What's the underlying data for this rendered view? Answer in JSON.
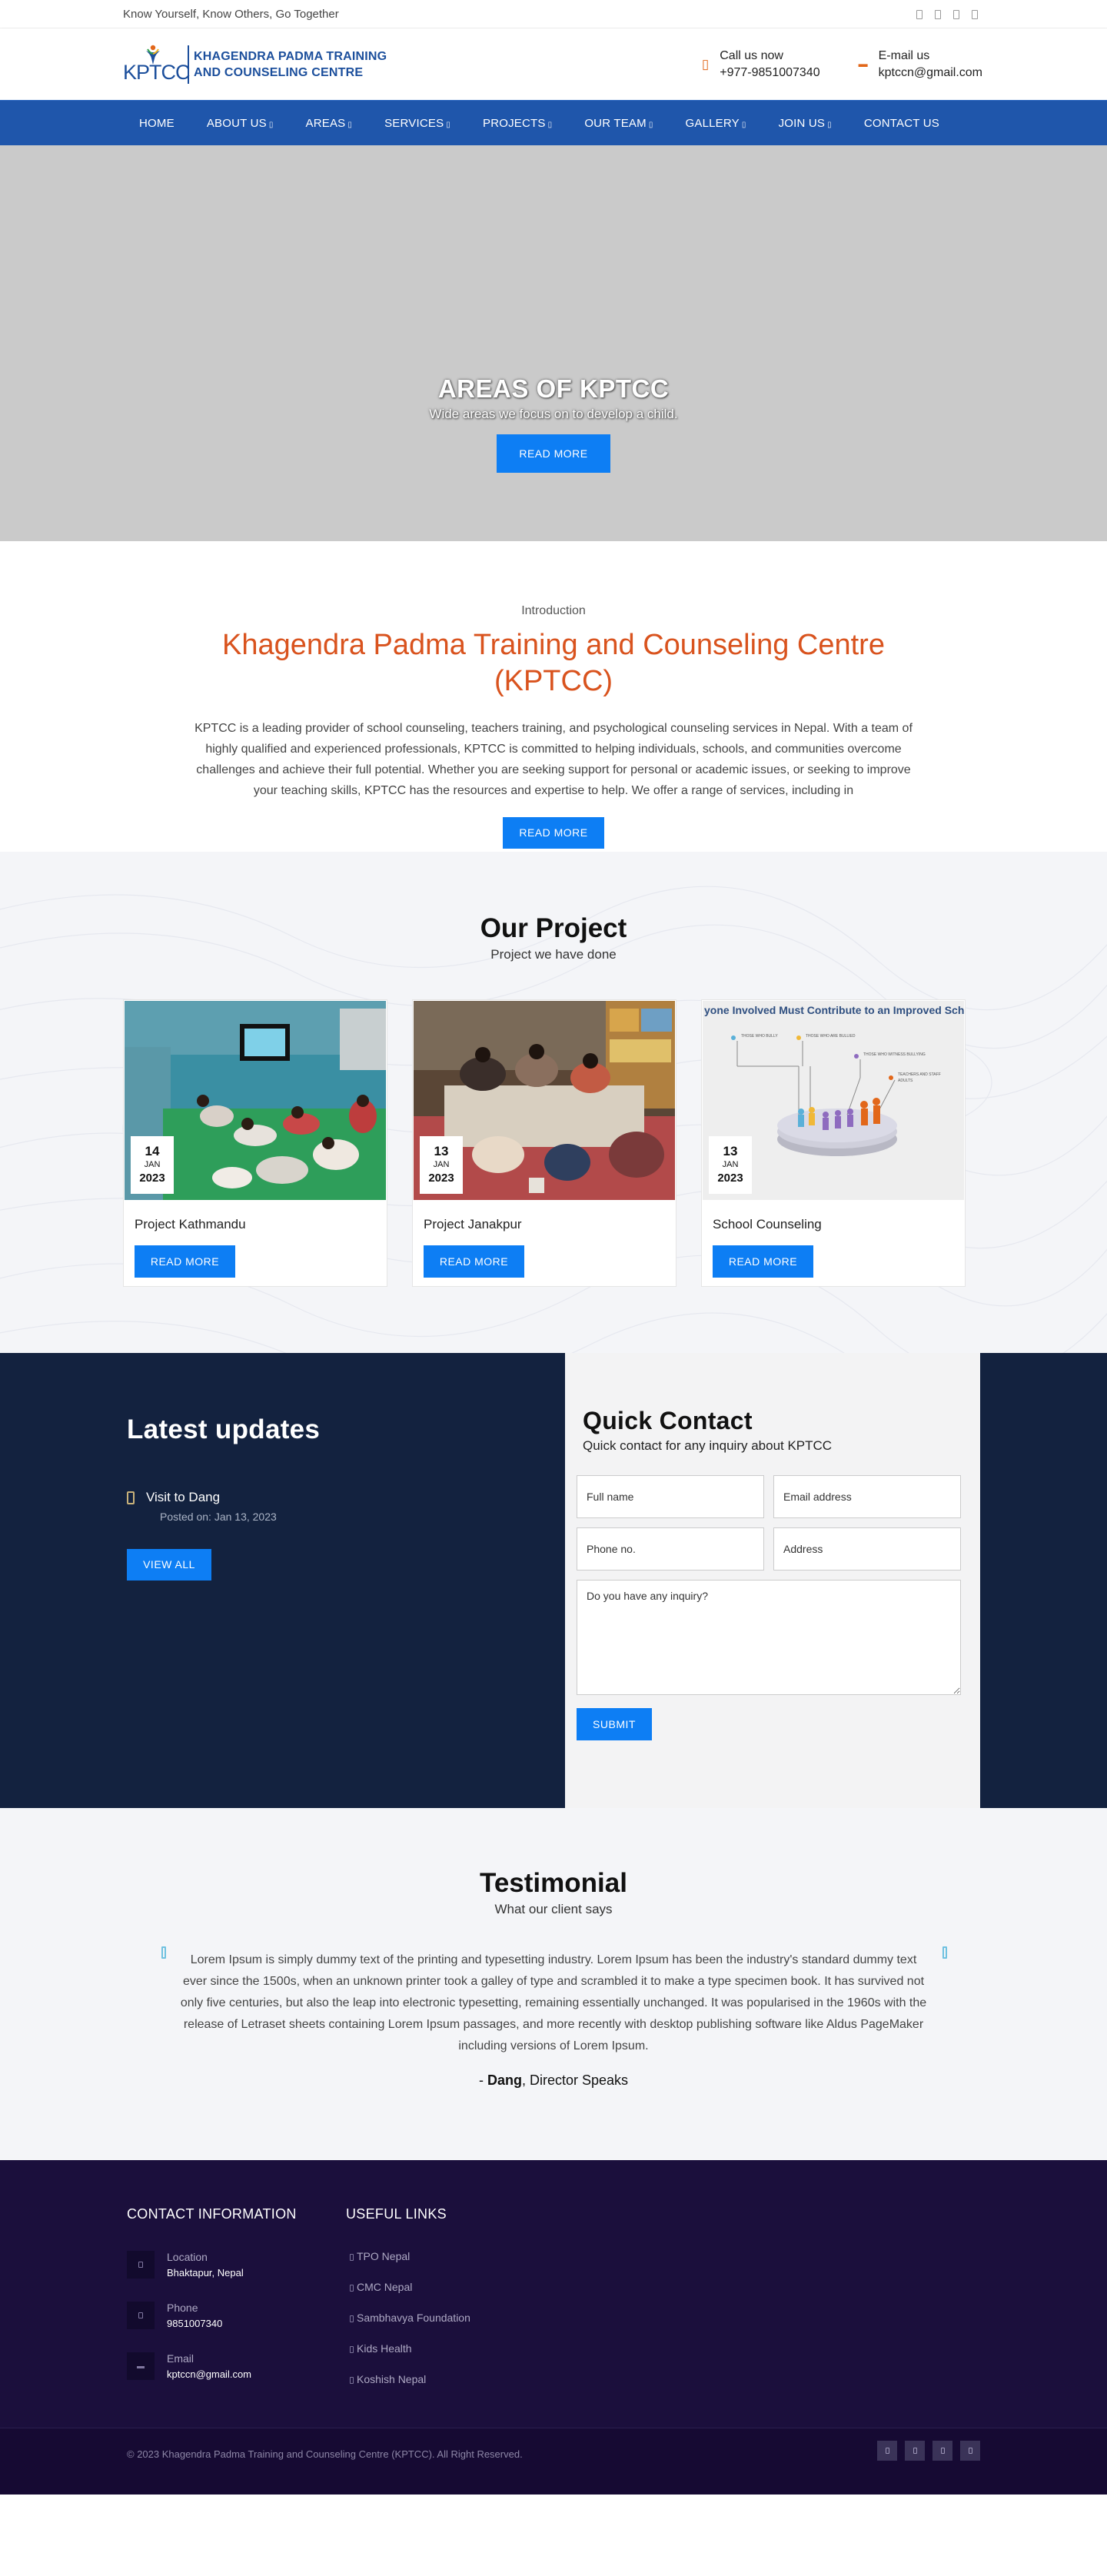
{
  "topbar": {
    "tagline": "Know Yourself, Know Others, Go Together",
    "social_icons": [
      "facebook-icon",
      "twitter-icon",
      "instagram-icon",
      "youtube-icon"
    ]
  },
  "header": {
    "logo_abbr": "KPTCC",
    "logo_name_line1": "KHAGENDRA PADMA TRAINING",
    "logo_name_line2": "AND COUNSELING CENTRE",
    "call_title": "Call us now",
    "call_value": "+977-9851007340",
    "email_title": "E-mail us",
    "email_value": "kptccn@gmail.com",
    "accent_color": "#e2671a",
    "brand_color": "#1c4f9c"
  },
  "nav": {
    "items": [
      {
        "label": "HOME",
        "dropdown": false
      },
      {
        "label": "ABOUT US",
        "dropdown": true
      },
      {
        "label": "AREAS",
        "dropdown": true
      },
      {
        "label": "SERVICES",
        "dropdown": true
      },
      {
        "label": "PROJECTS",
        "dropdown": true
      },
      {
        "label": "OUR TEAM",
        "dropdown": true
      },
      {
        "label": "GALLERY",
        "dropdown": true
      },
      {
        "label": "JOIN US",
        "dropdown": true
      },
      {
        "label": "CONTACT US",
        "dropdown": false
      }
    ],
    "bg_color": "#1f56ab"
  },
  "hero": {
    "title": "AREAS OF KPTCC",
    "subtitle": "Wide areas we focus on to develop a child.",
    "button": "READ MORE"
  },
  "intro": {
    "eyebrow": "Introduction",
    "title": "Khagendra Padma Training and Counseling Centre (KPTCC)",
    "body": "KPTCC is a leading provider of school counseling, teachers training, and psychological counseling services in Nepal. With a team of highly qualified and experienced professionals, KPTCC is committed to helping individuals, schools, and communities overcome challenges and achieve their full potential. Whether you are seeking support for personal or academic issues, or seeking to improve your teaching skills, KPTCC has the resources and expertise to help. We offer a range of services, including in",
    "button": "READ MORE",
    "title_color": "#d9531e"
  },
  "projects": {
    "title": "Our Project",
    "subtitle": "Project we have done",
    "cards": [
      {
        "day": "14",
        "month": "JAN",
        "year": "2023",
        "title": "Project Kathmandu",
        "button": "READ MORE"
      },
      {
        "day": "13",
        "month": "JAN",
        "year": "2023",
        "title": "Project Janakpur",
        "button": "READ MORE"
      },
      {
        "day": "13",
        "month": "JAN",
        "year": "2023",
        "title": "School Counseling",
        "button": "READ MORE",
        "image_heading": "yone Involved Must Contribute to an Improved School Cli",
        "image_labels": [
          "THOSE WHO BULLY",
          "THOSE WHO ARE BULLIED",
          "THOSE WHO WITNESS BULLYING",
          "TEACHERS AND STAFF",
          "ADULTS"
        ]
      }
    ]
  },
  "updates": {
    "title": "Latest updates",
    "items": [
      {
        "title": "Visit to Dang",
        "posted": "Posted on: Jan 13, 2023"
      }
    ],
    "button": "VIEW ALL"
  },
  "quick_contact": {
    "title": "Quick Contact",
    "subtitle": "Quick contact for any inquiry about KPTCC",
    "fields": {
      "name": "Full name",
      "email": "Email address",
      "phone": "Phone no.",
      "address": "Address",
      "inquiry": "Do you have any inquiry?"
    },
    "submit": "SUBMIT"
  },
  "testimonial": {
    "title": "Testimonial",
    "subtitle": "What our client says",
    "quote": "Lorem Ipsum is simply dummy text of the printing and typesetting industry. Lorem Ipsum has been the industry's standard dummy text ever since the 1500s, when an unknown printer took a galley of type and scrambled it to make a type specimen book. It has survived not only five centuries, but also the leap into electronic typesetting, remaining essentially unchanged. It was popularised in the 1960s with the release of Letraset sheets containing Lorem Ipsum passages, and more recently with desktop publishing software like Aldus PageMaker including versions of Lorem Ipsum.",
    "author_prefix": "- ",
    "author_name": "Dang",
    "author_role": ", Director Speaks"
  },
  "footer": {
    "contact_title": "CONTACT INFORMATION",
    "contact": [
      {
        "label": "Location",
        "value": "Bhaktapur, Nepal",
        "icon": "location-icon"
      },
      {
        "label": "Phone",
        "value": "9851007340",
        "icon": "phone-icon"
      },
      {
        "label": "Email",
        "value": "kptccn@gmail.com",
        "icon": "email-icon"
      }
    ],
    "links_title": "USEFUL LINKS",
    "links": [
      "TPO Nepal",
      "CMC Nepal",
      "Sambhavya Foundation",
      "Kids Health",
      "Koshish Nepal"
    ],
    "copyright": "© 2023 Khagendra Padma Training and Counseling Centre (KPTCC). All Right Reserved.",
    "social_icons": [
      "facebook-icon",
      "twitter-icon",
      "instagram-icon",
      "youtube-icon"
    ],
    "bg_color": "#1b0f3c"
  }
}
